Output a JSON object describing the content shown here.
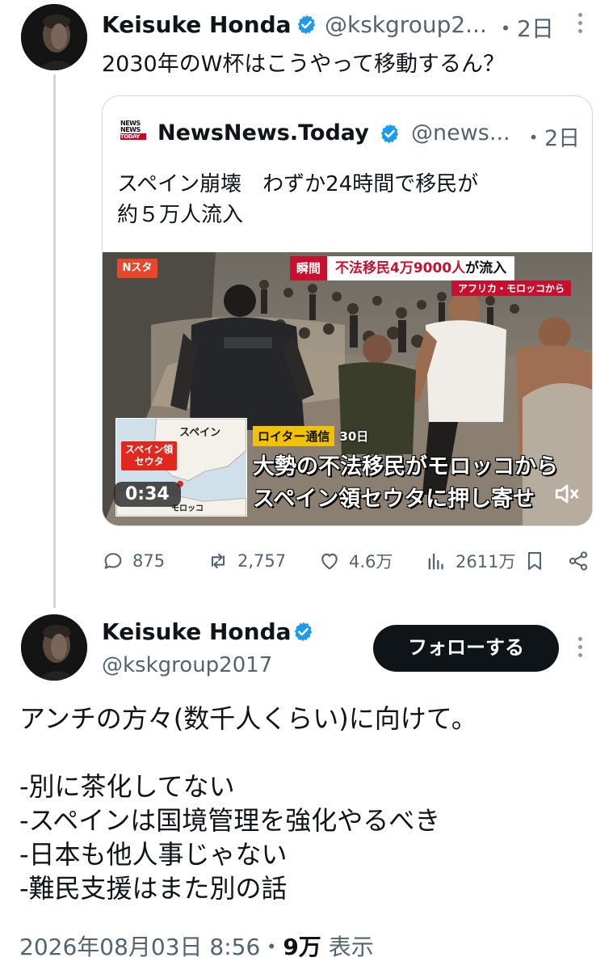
{
  "colors": {
    "verified": "#1d9bf0",
    "text": "#0f1419",
    "muted": "#536471",
    "breaking_red": "#c8102e"
  },
  "parent_tweet": {
    "author_name": "Keisuke Honda",
    "author_handle": "@kskgroup2...",
    "time": "・2日",
    "text": "2030年のW杯はこうやって移動するん？",
    "quoted": {
      "logo_text": [
        "NEWS",
        "NEWS",
        "TODAY"
      ],
      "author_name": "NewsNews.Today",
      "author_handle": "@news...",
      "time": "・2日",
      "text_lines": [
        "スペイン崩壊　わずか24時間で移民が",
        "約５万人流入"
      ],
      "video": {
        "channel_badge": "Nスタ",
        "breaking_tag": "瞬間",
        "breaking_head_a": "不法移民4万9000人",
        "breaking_head_b": "が流入",
        "breaking_sub": "アフリカ・モロッコから",
        "map_spain": "スペイン",
        "map_ceuta_1": "スペイン領",
        "map_ceuta_2": "セウタ",
        "map_morocco": "モロッコ",
        "duration": "0:34",
        "source_tag": "ロイター通信",
        "source_date": "30日",
        "caption_line_1": "大勢の不法移民がモロッコから",
        "caption_line_2": "スペイン領セウタに押し寄せ"
      }
    },
    "stats": {
      "replies": "875",
      "reposts": "2,757",
      "likes": "4.6万",
      "views": "2611万"
    }
  },
  "main_tweet": {
    "author_name": "Keisuke Honda",
    "author_handle": "@kskgroup2017",
    "follow_label": "フォローする",
    "text_lines": [
      "アンチの方々(数千人くらい)に向けて。",
      "",
      "-別に茶化してない",
      "-スペインは国境管理を強化やるべき",
      "-日本も他人事じゃない",
      "-難民支援はまた別の話"
    ],
    "timestamp": "2026年08月03日 8:56",
    "separator": "・",
    "views_count": "9万",
    "views_label": "表示"
  }
}
